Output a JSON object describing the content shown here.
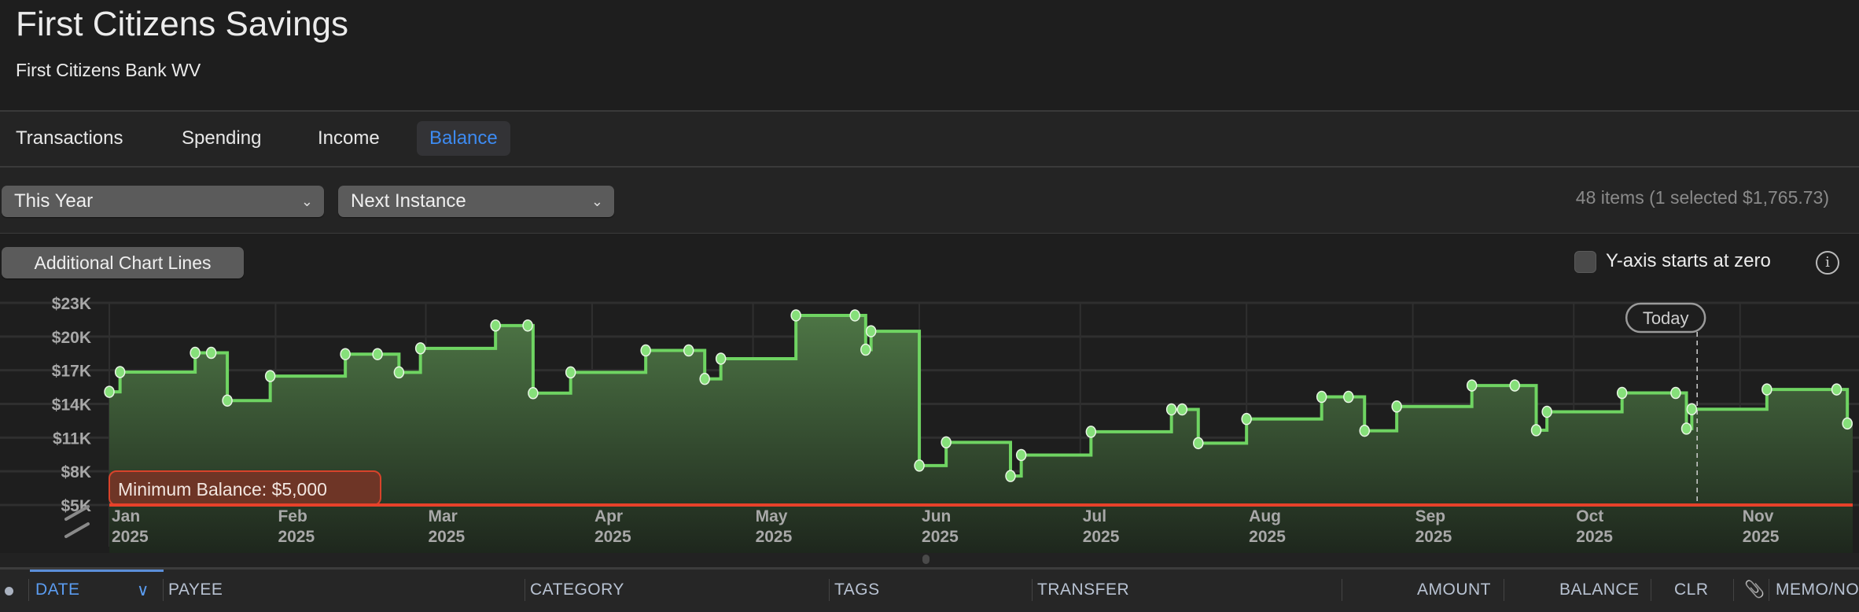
{
  "header": {
    "title": "First Citizens Savings",
    "subtitle": "First Citizens Bank WV"
  },
  "tabs": [
    {
      "label": "Transactions",
      "active": false
    },
    {
      "label": "Spending",
      "active": false
    },
    {
      "label": "Income",
      "active": false
    },
    {
      "label": "Balance",
      "active": true
    }
  ],
  "filters": {
    "period": "This Year",
    "recurring": "Next Instance",
    "chevron": "⌄"
  },
  "stats": "48 items (1 selected $1,765.73)",
  "chart_controls": {
    "additional_lines_label": "Additional Chart Lines",
    "y_zero_label": "Y-axis starts at zero",
    "y_zero_checked": false,
    "info_glyph": "i"
  },
  "colors": {
    "line": "#6fd462",
    "min_line": "#e8412a",
    "accent": "#3d8bf2"
  },
  "chart_data": {
    "type": "line",
    "title": "Balance",
    "step": true,
    "x_range": [
      "2025-01-01",
      "2025-11-22"
    ],
    "ylim": [
      5000,
      23000
    ],
    "y_ticks": [
      {
        "value": 23000,
        "label": "$23K"
      },
      {
        "value": 20000,
        "label": "$20K"
      },
      {
        "value": 17000,
        "label": "$17K"
      },
      {
        "value": 14000,
        "label": "$14K"
      },
      {
        "value": 11000,
        "label": "$11K"
      },
      {
        "value": 8000,
        "label": "$8K"
      },
      {
        "value": 5000,
        "label": "$5K"
      }
    ],
    "x_ticks": [
      {
        "date": "2025-01-01",
        "month": "Jan",
        "year": "2025"
      },
      {
        "date": "2025-02-01",
        "month": "Feb",
        "year": "2025"
      },
      {
        "date": "2025-03-01",
        "month": "Mar",
        "year": "2025"
      },
      {
        "date": "2025-04-01",
        "month": "Apr",
        "year": "2025"
      },
      {
        "date": "2025-05-01",
        "month": "May",
        "year": "2025"
      },
      {
        "date": "2025-06-01",
        "month": "Jun",
        "year": "2025"
      },
      {
        "date": "2025-07-01",
        "month": "Jul",
        "year": "2025"
      },
      {
        "date": "2025-08-01",
        "month": "Aug",
        "year": "2025"
      },
      {
        "date": "2025-09-01",
        "month": "Sep",
        "year": "2025"
      },
      {
        "date": "2025-10-01",
        "month": "Oct",
        "year": "2025"
      },
      {
        "date": "2025-11-01",
        "month": "Nov",
        "year": "2025"
      }
    ],
    "series": [
      {
        "name": "Balance",
        "points": [
          [
            "2025-01-01",
            15080
          ],
          [
            "2025-01-03",
            16840
          ],
          [
            "2025-01-17",
            18550
          ],
          [
            "2025-01-20",
            18550
          ],
          [
            "2025-01-23",
            14300
          ],
          [
            "2025-01-31",
            16480
          ],
          [
            "2025-02-14",
            18430
          ],
          [
            "2025-02-20",
            18430
          ],
          [
            "2025-02-24",
            16810
          ],
          [
            "2025-02-28",
            18950
          ],
          [
            "2025-03-14",
            20980
          ],
          [
            "2025-03-20",
            20980
          ],
          [
            "2025-03-21",
            14960
          ],
          [
            "2025-03-28",
            16810
          ],
          [
            "2025-04-11",
            18760
          ],
          [
            "2025-04-19",
            18760
          ],
          [
            "2025-04-22",
            16230
          ],
          [
            "2025-04-25",
            18030
          ],
          [
            "2025-05-09",
            21880
          ],
          [
            "2025-05-20",
            21880
          ],
          [
            "2025-05-22",
            18830
          ],
          [
            "2025-05-23",
            20470
          ],
          [
            "2025-06-01",
            8510
          ],
          [
            "2025-06-06",
            10580
          ],
          [
            "2025-06-18",
            7580
          ],
          [
            "2025-06-20",
            9450
          ],
          [
            "2025-07-03",
            11520
          ],
          [
            "2025-07-18",
            13510
          ],
          [
            "2025-07-20",
            13510
          ],
          [
            "2025-07-23",
            10510
          ],
          [
            "2025-08-01",
            12660
          ],
          [
            "2025-08-15",
            14630
          ],
          [
            "2025-08-20",
            14630
          ],
          [
            "2025-08-23",
            11610
          ],
          [
            "2025-08-29",
            13770
          ],
          [
            "2025-09-12",
            15640
          ],
          [
            "2025-09-20",
            15640
          ],
          [
            "2025-09-24",
            11660
          ],
          [
            "2025-09-26",
            13300
          ],
          [
            "2025-10-10",
            14980
          ],
          [
            "2025-10-20",
            14980
          ],
          [
            "2025-10-22",
            11800
          ],
          [
            "2025-10-23",
            13530
          ],
          [
            "2025-11-06",
            15290
          ],
          [
            "2025-11-19",
            15290
          ],
          [
            "2025-11-21",
            12260
          ]
        ]
      }
    ],
    "annotations": [
      {
        "type": "hline",
        "value": 5000,
        "label": "Minimum Balance: $5,000"
      },
      {
        "type": "vline",
        "date": "2025-10-24",
        "label": "Today"
      }
    ]
  },
  "table": {
    "columns": [
      "DATE",
      "PAYEE",
      "CATEGORY",
      "TAGS",
      "TRANSFER",
      "AMOUNT",
      "BALANCE",
      "CLR",
      "MEMO/NO"
    ],
    "sort_indicator": "∨",
    "attachment_glyph": "📎"
  }
}
